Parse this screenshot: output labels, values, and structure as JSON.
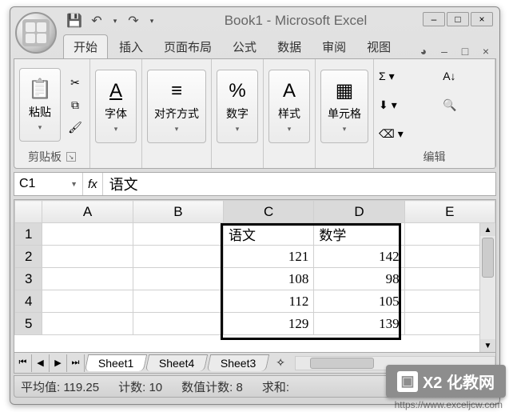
{
  "window": {
    "title": "Book1 - Microsoft Excel"
  },
  "tabs": {
    "home": "开始",
    "insert": "插入",
    "page_layout": "页面布局",
    "formulas": "公式",
    "data": "数据",
    "review": "审阅",
    "view": "视图"
  },
  "ribbon": {
    "clipboard": {
      "label": "剪贴板",
      "paste": "粘贴"
    },
    "font": {
      "label": "字体"
    },
    "alignment": {
      "label": "对齐方式"
    },
    "number": {
      "label": "数字"
    },
    "styles": {
      "label": "样式"
    },
    "cells": {
      "label": "单元格"
    },
    "editing": {
      "label": "编辑"
    }
  },
  "formula_bar": {
    "name_box": "C1",
    "fx": "fx",
    "value": "语文"
  },
  "grid": {
    "cols": [
      "A",
      "B",
      "C",
      "D",
      "E"
    ],
    "rows": [
      "1",
      "2",
      "3",
      "4",
      "5"
    ],
    "c1": "语文",
    "d1": "数学",
    "c2": "121",
    "d2": "142",
    "c3": "108",
    "d3": "98",
    "c4": "112",
    "d4": "105",
    "c5": "129",
    "d5": "139"
  },
  "sheets": {
    "s1": "Sheet1",
    "s2": "Sheet4",
    "s3": "Sheet3"
  },
  "status": {
    "avg_label": "平均值:",
    "avg_value": "119.25",
    "count_label": "计数:",
    "count_value": "10",
    "numcount_label": "数值计数:",
    "numcount_value": "8",
    "sum_label": "求和:"
  },
  "watermark": {
    "text": "X2 化教网",
    "url": "https://www.exceljcw.com"
  }
}
